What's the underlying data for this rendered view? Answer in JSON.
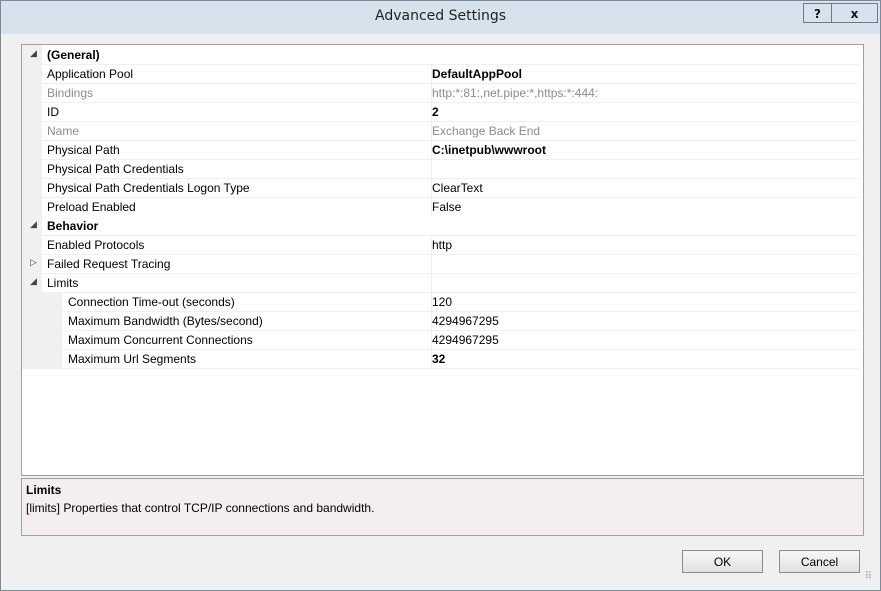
{
  "window": {
    "title": "Advanced Settings",
    "help_label": "?",
    "close_label": "x"
  },
  "grid": {
    "rows": [
      {
        "kind": "category",
        "expander": "◢",
        "name": "(General)",
        "value": ""
      },
      {
        "kind": "prop",
        "name": "Application Pool",
        "value": "DefaultAppPool",
        "bold": true
      },
      {
        "kind": "disabled",
        "name": "Bindings",
        "value": "http:*:81:,net.pipe:*,https:*:444:"
      },
      {
        "kind": "prop",
        "name": "ID",
        "value": "2",
        "bold": true
      },
      {
        "kind": "disabled",
        "name": "Name",
        "value": "Exchange Back End"
      },
      {
        "kind": "prop",
        "name": "Physical Path",
        "value": "C:\\inetpub\\wwwroot",
        "bold": true
      },
      {
        "kind": "prop",
        "name": "Physical Path Credentials",
        "value": ""
      },
      {
        "kind": "prop",
        "name": "Physical Path Credentials Logon Type",
        "value": "ClearText"
      },
      {
        "kind": "prop",
        "name": "Preload Enabled",
        "value": "False"
      },
      {
        "kind": "category",
        "expander": "◢",
        "name": "Behavior",
        "value": ""
      },
      {
        "kind": "prop",
        "name": "Enabled Protocols",
        "value": "http"
      },
      {
        "kind": "expandable",
        "expander": "▷",
        "name": "Failed Request Tracing",
        "value": ""
      },
      {
        "kind": "expandable",
        "expander": "◢",
        "name": "Limits",
        "value": ""
      },
      {
        "kind": "sub",
        "name": "Connection Time-out (seconds)",
        "value": "120"
      },
      {
        "kind": "sub",
        "name": "Maximum Bandwidth (Bytes/second)",
        "value": "4294967295"
      },
      {
        "kind": "sub",
        "name": "Maximum Concurrent Connections",
        "value": "4294967295"
      },
      {
        "kind": "sub",
        "name": "Maximum Url Segments",
        "value": "32",
        "bold": true
      }
    ]
  },
  "description": {
    "title": "Limits",
    "text": "[limits] Properties that control TCP/IP connections and bandwidth."
  },
  "buttons": {
    "ok_label": "OK",
    "cancel_label": "Cancel"
  },
  "icons": {
    "expanded": "triangle-expanded-icon",
    "collapsed": "triangle-collapsed-icon",
    "resize": "resize-grip-icon"
  }
}
